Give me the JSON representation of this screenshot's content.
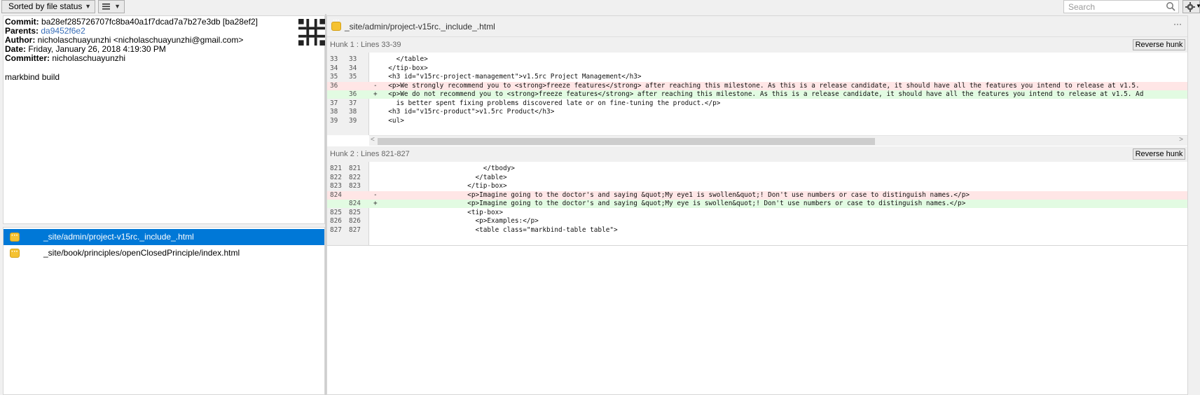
{
  "toolbar": {
    "sort_label": "Sorted by file status",
    "search_placeholder": "Search"
  },
  "commit": {
    "commit_label": "Commit:",
    "commit_value": "ba28ef285726707fc8ba40a1f7dcad7a7b27e3db [ba28ef2]",
    "parents_label": "Parents:",
    "parents_value": "da9452f6e2",
    "author_label": "Author:",
    "author_value": "nicholaschuayunzhi <nicholaschuayunzhi@gmail.com>",
    "date_label": "Date:",
    "date_value": "Friday, January 26, 2018 4:19:30 PM",
    "committer_label": "Committer:",
    "committer_value": "nicholaschuayunzhi",
    "message": "markbind build"
  },
  "files": [
    {
      "name": "_site/admin/project-v15rc._include_.html"
    },
    {
      "name": "_site/book/principles/openClosedPrinciple/index.html"
    }
  ],
  "diff": {
    "file_title": "_site/admin/project-v15rc._include_.html",
    "more": "···",
    "reverse_label": "Reverse hunk",
    "hunks": [
      {
        "label": "Hunk 1 : Lines 33-39",
        "lines": [
          {
            "o": "33",
            "n": "33",
            "m": "",
            "t": "    </table>",
            "k": "ctx"
          },
          {
            "o": "34",
            "n": "34",
            "m": "",
            "t": "  </tip-box>",
            "k": "ctx"
          },
          {
            "o": "35",
            "n": "35",
            "m": "",
            "t": "  <h3 id=\"v15rc-project-management\">v1.5rc Project Management</h3>",
            "k": "ctx"
          },
          {
            "o": "36",
            "n": "",
            "m": "-",
            "t": "  <p>We strongly recommend you to <strong>freeze features</strong> after reaching this milestone. As this is a release candidate, it should have all the features you intend to release at v1.5.",
            "k": "del"
          },
          {
            "o": "",
            "n": "36",
            "m": "+",
            "t": "  <p>We do not recommend you to <strong>freeze features</strong> after reaching this milestone. As this is a release candidate, it should have all the features you intend to release at v1.5. Ad",
            "k": "add"
          },
          {
            "o": "37",
            "n": "37",
            "m": "",
            "t": "    is better spent fixing problems discovered late or on fine-tuning the product.</p>",
            "k": "ctx"
          },
          {
            "o": "38",
            "n": "38",
            "m": "",
            "t": "  <h3 id=\"v15rc-product\">v1.5rc Product</h3>",
            "k": "ctx"
          },
          {
            "o": "39",
            "n": "39",
            "m": "",
            "t": "  <ul>",
            "k": "ctx"
          }
        ]
      },
      {
        "label": "Hunk 2 : Lines 821-827",
        "lines": [
          {
            "o": "821",
            "n": "821",
            "m": "",
            "t": "                          </tbody>",
            "k": "ctx"
          },
          {
            "o": "822",
            "n": "822",
            "m": "",
            "t": "                        </table>",
            "k": "ctx"
          },
          {
            "o": "823",
            "n": "823",
            "m": "",
            "t": "                      </tip-box>",
            "k": "ctx"
          },
          {
            "o": "824",
            "n": "",
            "m": "-",
            "t": "                      <p>Imagine going to the doctor's and saying &quot;My eye1 is swollen&quot;! Don't use numbers or case to distinguish names.</p>",
            "k": "del"
          },
          {
            "o": "",
            "n": "824",
            "m": "+",
            "t": "                      <p>Imagine going to the doctor's and saying &quot;My eye is swollen&quot;! Don't use numbers or case to distinguish names.</p>",
            "k": "add"
          },
          {
            "o": "825",
            "n": "825",
            "m": "",
            "t": "                      <tip-box>",
            "k": "ctx"
          },
          {
            "o": "826",
            "n": "826",
            "m": "",
            "t": "                        <p>Examples:</p>",
            "k": "ctx"
          },
          {
            "o": "827",
            "n": "827",
            "m": "",
            "t": "                        <table class=\"markbind-table table\">",
            "k": "ctx"
          }
        ]
      }
    ]
  }
}
